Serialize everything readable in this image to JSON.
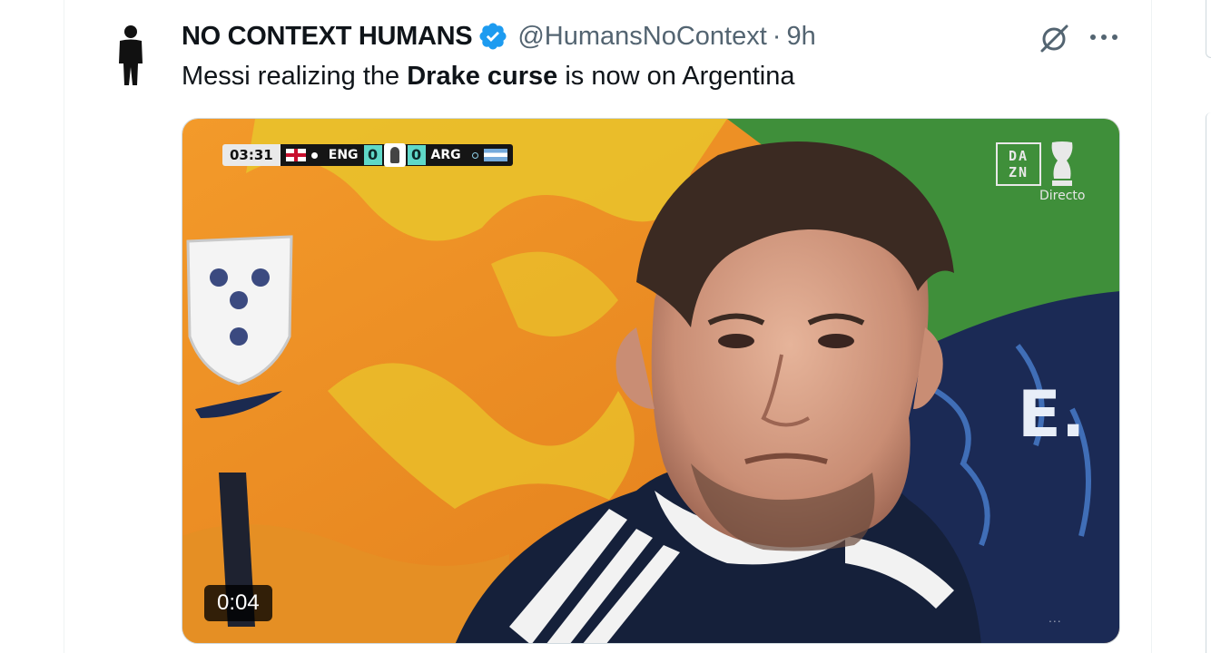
{
  "tweet": {
    "author_name": "NO CONTEXT HUMANS",
    "handle": "@HumansNoContext",
    "separator": "·",
    "time": "9h",
    "text_before": "Messi realizing the ",
    "text_bold": "Drake curse",
    "text_after": " is now on Argentina"
  },
  "icons": {
    "avatar": "standing-person-icon",
    "verified": "verified-badge-icon",
    "grok": "grok-icon",
    "more": "more-options-icon"
  },
  "media": {
    "duration": "0:04",
    "scorebug": {
      "clock": "03:31",
      "home_team": "ENG",
      "home_score": "0",
      "away_score": "0",
      "away_team": "ARG"
    },
    "broadcaster_line1": "DA",
    "broadcaster_line2": "ZN",
    "live_label": "Directo",
    "overlay_dots": "..."
  },
  "colors": {
    "verified_blue": "#1d9bf0",
    "text_primary": "#0f1419",
    "text_secondary": "#536471",
    "border": "#cfd9de"
  }
}
